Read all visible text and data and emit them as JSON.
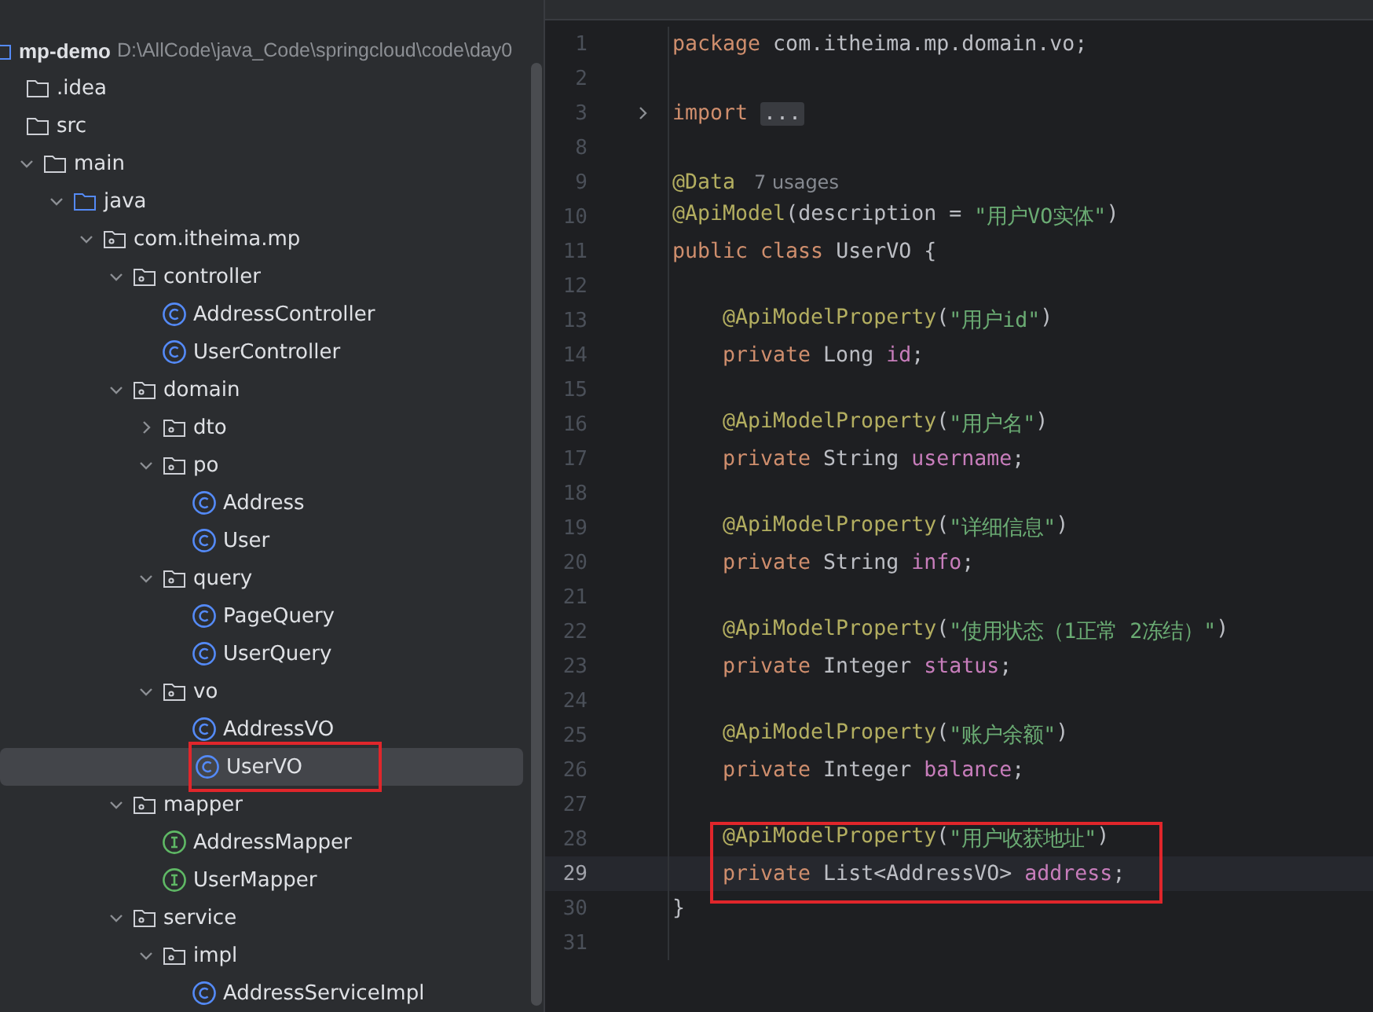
{
  "project": {
    "name": "mp-demo",
    "path": "D:\\AllCode\\java_Code\\springcloud\\code\\day0"
  },
  "tree": [
    {
      "label": ".idea",
      "kind": "folder",
      "selected": false
    },
    {
      "label": "src",
      "kind": "folder",
      "selected": false,
      "children": [
        {
          "label": "main",
          "kind": "folder",
          "expanded": true,
          "selected": false,
          "children": [
            {
              "label": "java",
              "kind": "source-folder",
              "expanded": true,
              "selected": false,
              "children": [
                {
                  "label": "com.itheima.mp",
                  "kind": "package",
                  "expanded": true,
                  "selected": false,
                  "children": [
                    {
                      "label": "controller",
                      "kind": "package",
                      "expanded": true,
                      "selected": false,
                      "children": [
                        {
                          "label": "AddressController",
                          "kind": "class",
                          "selected": false
                        },
                        {
                          "label": "UserController",
                          "kind": "class",
                          "selected": false
                        }
                      ]
                    },
                    {
                      "label": "domain",
                      "kind": "package",
                      "expanded": true,
                      "selected": false,
                      "children": [
                        {
                          "label": "dto",
                          "kind": "package",
                          "expanded": false,
                          "selected": false
                        },
                        {
                          "label": "po",
                          "kind": "package",
                          "expanded": true,
                          "selected": false,
                          "children": [
                            {
                              "label": "Address",
                              "kind": "class",
                              "selected": false
                            },
                            {
                              "label": "User",
                              "kind": "class",
                              "selected": false
                            }
                          ]
                        },
                        {
                          "label": "query",
                          "kind": "package",
                          "expanded": true,
                          "selected": false,
                          "children": [
                            {
                              "label": "PageQuery",
                              "kind": "class",
                              "selected": false
                            },
                            {
                              "label": "UserQuery",
                              "kind": "class",
                              "selected": false
                            }
                          ]
                        },
                        {
                          "label": "vo",
                          "kind": "package",
                          "expanded": true,
                          "selected": false,
                          "children": [
                            {
                              "label": "AddressVO",
                              "kind": "class",
                              "selected": false
                            },
                            {
                              "label": "UserVO",
                              "kind": "class",
                              "selected": true,
                              "highlighted": true
                            }
                          ]
                        }
                      ]
                    },
                    {
                      "label": "mapper",
                      "kind": "package",
                      "expanded": true,
                      "selected": false,
                      "children": [
                        {
                          "label": "AddressMapper",
                          "kind": "interface",
                          "selected": false
                        },
                        {
                          "label": "UserMapper",
                          "kind": "interface",
                          "selected": false
                        }
                      ]
                    },
                    {
                      "label": "service",
                      "kind": "package",
                      "expanded": true,
                      "selected": false,
                      "children": [
                        {
                          "label": "impl",
                          "kind": "package",
                          "expanded": true,
                          "selected": false,
                          "children": [
                            {
                              "label": "AddressServiceImpl",
                              "kind": "class",
                              "selected": false
                            }
                          ]
                        }
                      ]
                    }
                  ]
                }
              ]
            }
          ]
        }
      ]
    }
  ],
  "code_lines": [
    {
      "number": "1",
      "tokens": [
        {
          "kind": "keyword",
          "text": "package"
        },
        {
          "kind": "plain",
          "text": " com.itheima.mp.domain.vo;"
        }
      ]
    },
    {
      "number": "2"
    },
    {
      "number": "3",
      "fold": true,
      "tokens": [
        {
          "kind": "keyword",
          "text": "import"
        },
        {
          "kind": "folded",
          "text": "..."
        }
      ]
    },
    {
      "number": "8"
    },
    {
      "number": "9",
      "tokens": [
        {
          "kind": "annotation",
          "text": "@Data"
        },
        {
          "kind": "hint",
          "text": "7 usages"
        }
      ]
    },
    {
      "number": "10",
      "tokens": [
        {
          "kind": "annotation",
          "text": "@ApiModel"
        },
        {
          "kind": "plain",
          "text": "(description = "
        },
        {
          "kind": "string",
          "text": "\"用户VO实体\""
        },
        {
          "kind": "plain",
          "text": ")"
        }
      ]
    },
    {
      "number": "11",
      "tokens": [
        {
          "kind": "keyword",
          "text": "public class"
        },
        {
          "kind": "plain",
          "text": " UserVO {"
        }
      ]
    },
    {
      "number": "12"
    },
    {
      "number": "13",
      "indented": true,
      "tokens": [
        {
          "kind": "annotation",
          "text": "@ApiModelProperty"
        },
        {
          "kind": "plain",
          "text": "("
        },
        {
          "kind": "string",
          "text": "\"用户id\""
        },
        {
          "kind": "plain",
          "text": ")"
        }
      ]
    },
    {
      "number": "14",
      "indented": true,
      "tokens": [
        {
          "kind": "keyword",
          "text": "private"
        },
        {
          "kind": "plain",
          "text": " Long "
        },
        {
          "kind": "field",
          "text": "id"
        },
        {
          "kind": "plain",
          "text": ";"
        }
      ]
    },
    {
      "number": "15"
    },
    {
      "number": "16",
      "indented": true,
      "tokens": [
        {
          "kind": "annotation",
          "text": "@ApiModelProperty"
        },
        {
          "kind": "plain",
          "text": "("
        },
        {
          "kind": "string",
          "text": "\"用户名\""
        },
        {
          "kind": "plain",
          "text": ")"
        }
      ]
    },
    {
      "number": "17",
      "indented": true,
      "tokens": [
        {
          "kind": "keyword",
          "text": "private"
        },
        {
          "kind": "plain",
          "text": " String "
        },
        {
          "kind": "field",
          "text": "username"
        },
        {
          "kind": "plain",
          "text": ";"
        }
      ]
    },
    {
      "number": "18"
    },
    {
      "number": "19",
      "indented": true,
      "tokens": [
        {
          "kind": "annotation",
          "text": "@ApiModelProperty"
        },
        {
          "kind": "plain",
          "text": "("
        },
        {
          "kind": "string",
          "text": "\"详细信息\""
        },
        {
          "kind": "plain",
          "text": ")"
        }
      ]
    },
    {
      "number": "20",
      "indented": true,
      "tokens": [
        {
          "kind": "keyword",
          "text": "private"
        },
        {
          "kind": "plain",
          "text": " String "
        },
        {
          "kind": "field",
          "text": "info"
        },
        {
          "kind": "plain",
          "text": ";"
        }
      ]
    },
    {
      "number": "21"
    },
    {
      "number": "22",
      "indented": true,
      "tokens": [
        {
          "kind": "annotation",
          "text": "@ApiModelProperty"
        },
        {
          "kind": "plain",
          "text": "("
        },
        {
          "kind": "string",
          "text": "\"使用状态（1正常 2冻结）\""
        },
        {
          "kind": "plain",
          "text": ")"
        }
      ]
    },
    {
      "number": "23",
      "indented": true,
      "tokens": [
        {
          "kind": "keyword",
          "text": "private"
        },
        {
          "kind": "plain",
          "text": " Integer "
        },
        {
          "kind": "field",
          "text": "status"
        },
        {
          "kind": "plain",
          "text": ";"
        }
      ]
    },
    {
      "number": "24"
    },
    {
      "number": "25",
      "indented": true,
      "tokens": [
        {
          "kind": "annotation",
          "text": "@ApiModelProperty"
        },
        {
          "kind": "plain",
          "text": "("
        },
        {
          "kind": "string",
          "text": "\"账户余额\""
        },
        {
          "kind": "plain",
          "text": ")"
        }
      ]
    },
    {
      "number": "26",
      "indented": true,
      "tokens": [
        {
          "kind": "keyword",
          "text": "private"
        },
        {
          "kind": "plain",
          "text": " Integer "
        },
        {
          "kind": "field",
          "text": "balance"
        },
        {
          "kind": "plain",
          "text": ";"
        }
      ]
    },
    {
      "number": "27"
    },
    {
      "number": "28",
      "indented": true,
      "highlighted": true,
      "tokens": [
        {
          "kind": "annotation",
          "text": "@ApiModelProperty"
        },
        {
          "kind": "plain",
          "text": "("
        },
        {
          "kind": "string",
          "text": "\"用户收获地址\""
        },
        {
          "kind": "plain",
          "text": ")"
        }
      ]
    },
    {
      "number": "29",
      "indented": true,
      "highlighted": true,
      "current": true,
      "tokens": [
        {
          "kind": "keyword",
          "text": "private"
        },
        {
          "kind": "plain",
          "text": " List<AddressVO> "
        },
        {
          "kind": "field",
          "text": "address"
        },
        {
          "kind": "plain",
          "text": ";"
        }
      ]
    },
    {
      "number": "30",
      "tokens": [
        {
          "kind": "plain",
          "text": "}"
        }
      ]
    },
    {
      "number": "31"
    }
  ]
}
